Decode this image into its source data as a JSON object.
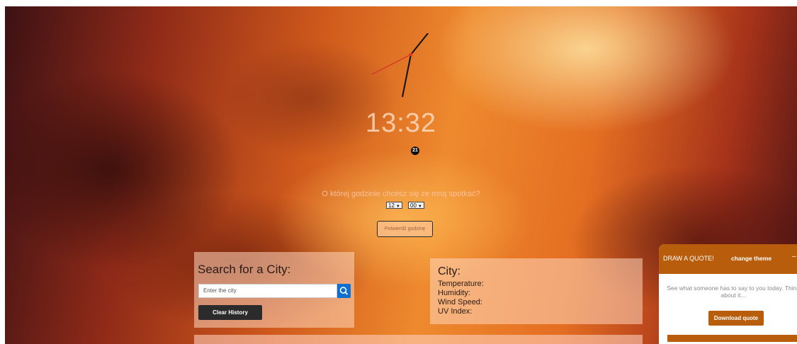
{
  "clock": {
    "time": "13:32",
    "date_badge": "21"
  },
  "meeting": {
    "question": "O której godzinie chcesz się ze mną spotkać?",
    "hour_value": "12",
    "minute_value": "00",
    "confirm_label": "Potwierdź godzinę"
  },
  "search": {
    "title": "Search for a City:",
    "input_placeholder": "Enter the city",
    "clear_label": "Clear History"
  },
  "weather": {
    "city_label": "City:",
    "temperature_label": "Temperature:",
    "humidity_label": "Humidity:",
    "wind_label": "Wind Speed:",
    "uv_label": "UV Index:"
  },
  "quote": {
    "title": "DRAW A QUOTE!",
    "theme_label": "change theme",
    "minimize_label": "–",
    "text": "See what someone has to say to you today. Think about it...",
    "download_label": "Download quote"
  },
  "colors": {
    "accent": "#b85d0c",
    "search_button": "#0f6fcf",
    "dark_button": "#2b2b2b"
  }
}
